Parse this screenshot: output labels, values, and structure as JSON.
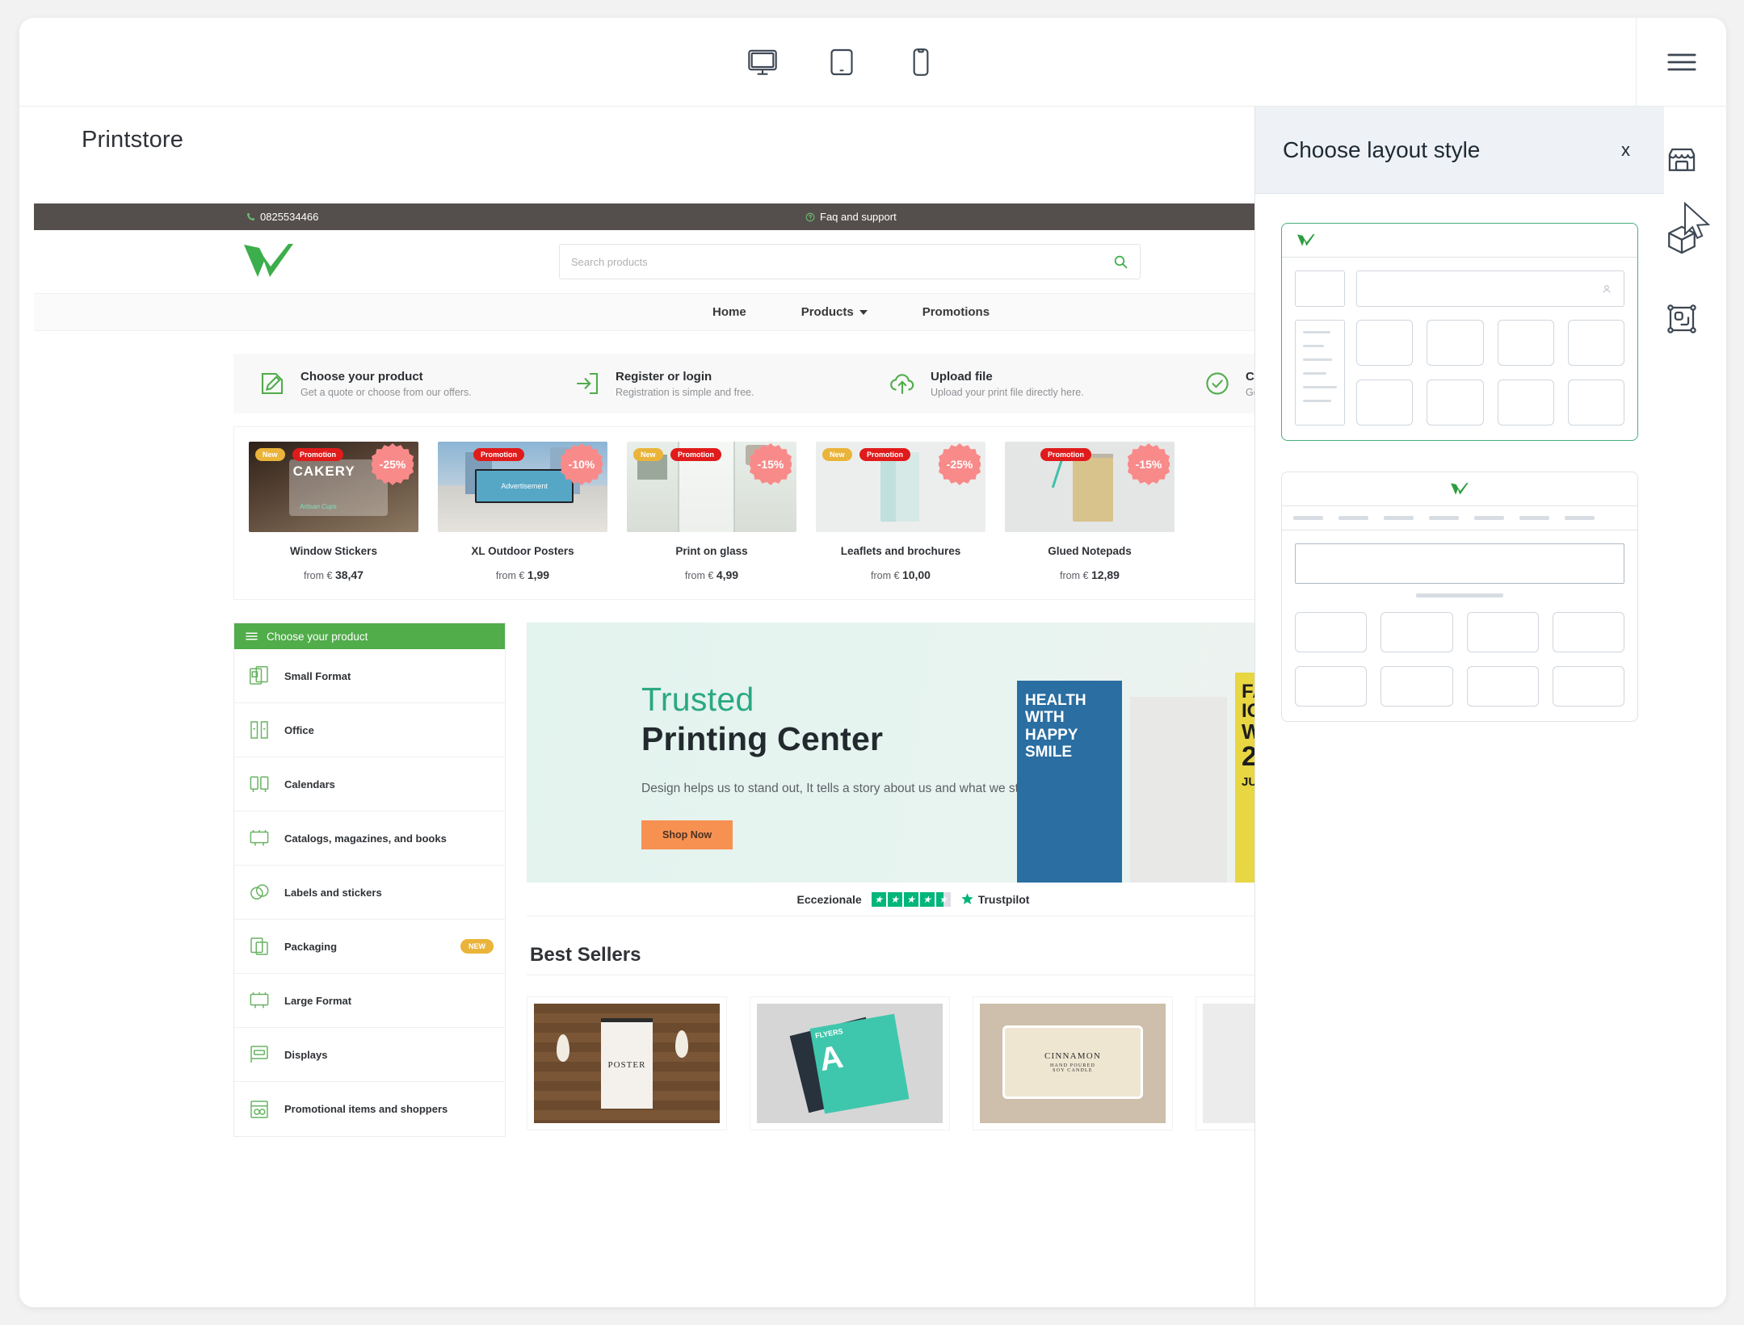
{
  "editor": {
    "device_tabs": [
      {
        "name": "desktop",
        "icon": "monitor-icon",
        "active": true
      },
      {
        "name": "tablet",
        "icon": "tablet-icon",
        "active": false
      },
      {
        "name": "mobile",
        "icon": "mobile-icon",
        "active": false
      }
    ],
    "rail": {
      "menu_icon": "hamburger-menu-icon",
      "items": [
        {
          "name": "store",
          "icon": "storefront-icon"
        },
        {
          "name": "products",
          "icon": "box-3d-icon"
        },
        {
          "name": "layout",
          "icon": "layout-frame-icon"
        }
      ]
    },
    "canvas_title": "Printstore"
  },
  "panel": {
    "title": "Choose layout style",
    "close_label": "x",
    "accent_selected": "#46b07a",
    "options": [
      {
        "name": "sidebar-grid-layout",
        "selected": true,
        "logo_align": "left",
        "has_sidebar": true,
        "has_navbar": false,
        "tile_rows": 2,
        "tiles_per_row": 4
      },
      {
        "name": "centered-hero-layout",
        "selected": false,
        "logo_align": "center",
        "has_sidebar": false,
        "has_navbar": true,
        "nav_links": 7,
        "tile_rows": 2,
        "tiles_per_row": 4
      }
    ]
  },
  "site": {
    "topbar": {
      "phone": "0825534466",
      "phone_icon": "phone-icon",
      "faq": "Faq and support",
      "faq_icon": "help-circle-icon",
      "bg": "#544f4c"
    },
    "header": {
      "logo_name": "w-checkmark-logo",
      "logo_color": "#3cae4b",
      "search_placeholder": "Search products",
      "search_value": "",
      "search_icon": "search-icon"
    },
    "nav": {
      "items": [
        {
          "label": "Home",
          "has_caret": false
        },
        {
          "label": "Products",
          "has_caret": true
        },
        {
          "label": "Promotions",
          "has_caret": false
        }
      ]
    },
    "features": [
      {
        "icon": "pencil-square-icon",
        "title": "Choose your product",
        "desc": "Get a quote or choose from our offers."
      },
      {
        "icon": "login-arrow-icon",
        "title": "Register or login",
        "desc": "Registration is simple and free."
      },
      {
        "icon": "cloud-upload-icon",
        "title": "Upload file",
        "desc": "Upload your print file directly here."
      },
      {
        "icon": "check-circle-icon",
        "title": "Confirm",
        "desc": "Get pro"
      }
    ],
    "promo_products": [
      {
        "title": "Window Stickers",
        "price_prefix": "from €",
        "price": "38,47",
        "new": "New",
        "promo": "Promotion",
        "discount": "-25%",
        "img": "cakery-window-sticker"
      },
      {
        "title": "XL Outdoor Posters",
        "price_prefix": "from €",
        "price": "1,99",
        "new": "",
        "promo": "Promotion",
        "discount": "-10%",
        "img": "outdoor-billboard"
      },
      {
        "title": "Print on glass",
        "price_prefix": "from €",
        "price": "4,99",
        "new": "New",
        "promo": "Promotion",
        "discount": "-15%",
        "img": "glass-print-kitchen"
      },
      {
        "title": "Leaflets and brochures",
        "price_prefix": "from €",
        "price": "10,00",
        "new": "New",
        "promo": "Promotion",
        "discount": "-25%",
        "img": "folded-brochure"
      },
      {
        "title": "Glued Notepads",
        "price_prefix": "from €",
        "price": "12,89",
        "new": "",
        "promo": "Promotion",
        "discount": "-15%",
        "img": "ringed-notepad"
      }
    ],
    "categories": {
      "header": "Choose your product",
      "header_icon": "hamburger-menu-icon",
      "header_bg": "#51ac4a",
      "items": [
        {
          "label": "Small Format",
          "icon": "small-format-icon",
          "tag": ""
        },
        {
          "label": "Office",
          "icon": "office-icon",
          "tag": ""
        },
        {
          "label": "Calendars",
          "icon": "calendar-icon",
          "tag": ""
        },
        {
          "label": "Catalogs, magazines, and books",
          "icon": "catalog-icon",
          "tag": ""
        },
        {
          "label": "Labels and stickers",
          "icon": "labels-icon",
          "tag": ""
        },
        {
          "label": "Packaging",
          "icon": "packaging-icon",
          "tag": "NEW"
        },
        {
          "label": "Large Format",
          "icon": "large-format-icon",
          "tag": ""
        },
        {
          "label": "Displays",
          "icon": "display-icon",
          "tag": ""
        },
        {
          "label": "Promotional items and shoppers",
          "icon": "promo-items-icon",
          "tag": ""
        }
      ]
    },
    "hero": {
      "line1": "Trusted",
      "line2": "Printing Center",
      "body": "Design helps us to stand out, It tells a story about us and what we stand for.",
      "cta": "Shop Now",
      "cta_color": "#f79152",
      "line1_color": "#2aa882"
    },
    "trustpilot": {
      "rating_word": "Eccezionale",
      "stars_full": 4,
      "stars_half": 1,
      "brand": "Trustpilot",
      "star_color": "#00b67a"
    },
    "best_sellers": {
      "title": "Best Sellers",
      "items": [
        {
          "name": "poster-hanging-wood",
          "label": "POSTER"
        },
        {
          "name": "flyers-stack-teal",
          "label": "FLYERS"
        },
        {
          "name": "cinnamon-label-roll",
          "label": "CINNAMON"
        },
        {
          "name": "fourth-card-partial",
          "label": ""
        }
      ]
    }
  }
}
